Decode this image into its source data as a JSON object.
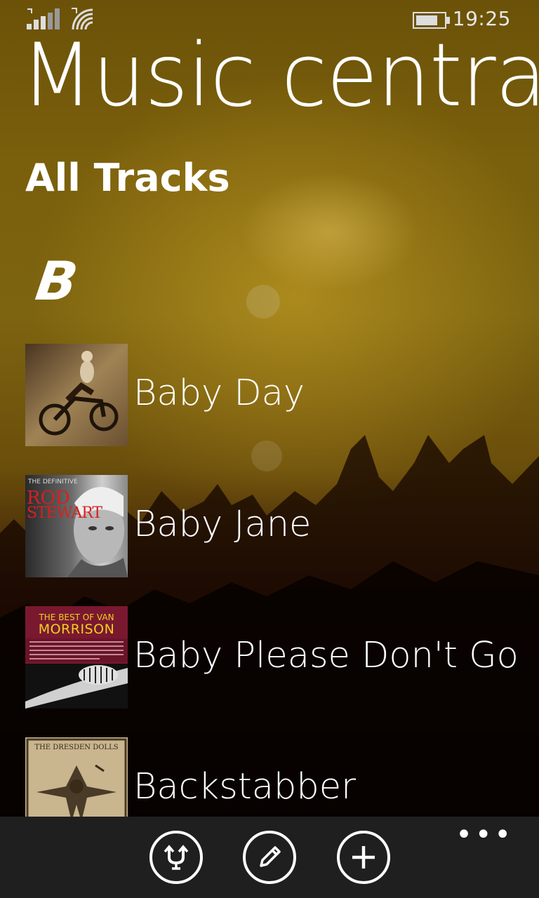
{
  "status_bar": {
    "time": "19:25"
  },
  "app": {
    "title": "Music centra"
  },
  "section": {
    "title": "All Tracks",
    "group_letter": "B"
  },
  "tracks": [
    {
      "title": "Baby Day",
      "cover_text": []
    },
    {
      "title": "Baby Jane",
      "cover_text": [
        "THE DEFINITIVE",
        "ROD",
        "STEWART"
      ]
    },
    {
      "title": "Baby Please Don't Go",
      "cover_text": [
        "THE BEST OF VAN",
        "MORRISON"
      ]
    },
    {
      "title": "Backstabber",
      "cover_text": [
        "THE DRESDEN DOLLS"
      ]
    }
  ],
  "app_bar": {
    "buttons": [
      {
        "icon": "shuffle-icon"
      },
      {
        "icon": "edit-icon"
      },
      {
        "icon": "add-icon"
      }
    ],
    "more_label": "•••"
  }
}
